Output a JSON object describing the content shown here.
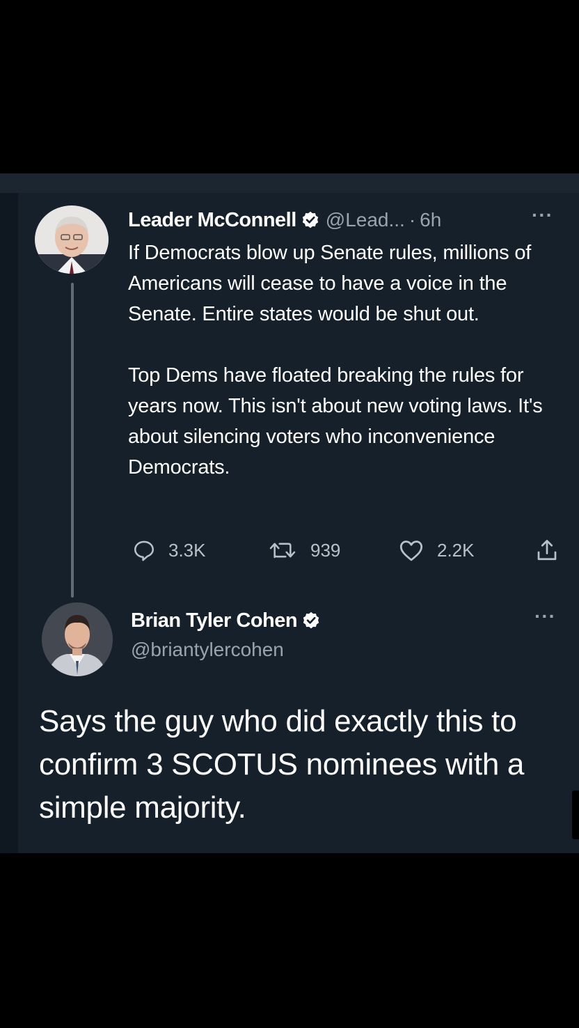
{
  "original_tweet": {
    "author_name": "Leader McConnell",
    "handle": "@Lead...",
    "separator": "·",
    "time": "6h",
    "more_label": "···",
    "paragraphs": [
      "If Democrats blow up Senate rules, millions of Americans will cease to have a voice in the Senate. Entire states would be shut out.",
      "Top Dems have floated breaking the rules for years now. This isn't about new voting laws. It's about silencing voters who inconvenience Democrats."
    ],
    "actions": {
      "replies": "3.3K",
      "retweets": "939",
      "likes": "2.2K"
    },
    "icons": [
      "verified-badge-icon",
      "reply-icon",
      "retweet-icon",
      "like-icon",
      "share-icon"
    ]
  },
  "reply_tweet": {
    "author_name": "Brian Tyler Cohen",
    "handle": "@briantylercohen",
    "more_label": "···",
    "text": "Says the guy who did exactly this to confirm 3 SCOTUS nominees with a simple majority."
  },
  "colors": {
    "page_background": "#000000",
    "card_background": "#15202b",
    "primary_text": "#ffffff",
    "secondary_text": "#9aa4ae",
    "verified_badge": "#ffffff",
    "thread_line": "#5e6a76"
  }
}
